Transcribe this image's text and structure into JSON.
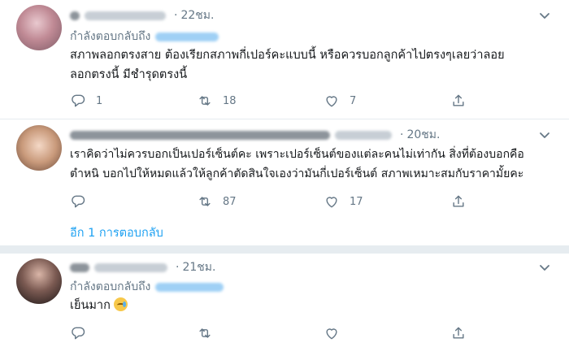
{
  "tweets": [
    {
      "time": "22ชม.",
      "reply_prefix": "กำลังตอบกลับถึง",
      "lines": [
        "สภาพลอกตรงสาย  ต้องเรียกสภาพกี่เปอร์คะแบบนี้    หรือควรบอกลูกค้าไปตรงๆเลยว่าลอย",
        "ลอกตรงนี้ มีชำรุดตรงนี้"
      ],
      "reply_count": "1",
      "retweet_count": "18",
      "like_count": "7"
    },
    {
      "time": "20ชม.",
      "lines": [
        "เราคิดว่าไม่ควรบอกเป็นเปอร์เซ็นต์คะ  เพราะเปอร์เซ็นต์ของแต่ละคนไม่เท่ากัน  สิ่งที่ต้องบอกคือ",
        "ตำหนิ  บอกไปให้หมดแล้วให้ลูกค้าตัดสินใจเองว่ามันกี่เปอร์เซ็นต์  สภาพเหมาะสมกับราคามั้ยคะ"
      ],
      "reply_count": "",
      "retweet_count": "87",
      "like_count": "17"
    },
    {
      "time": "21ชม.",
      "reply_prefix": "กำลังตอบกลับถึง",
      "lines": [
        "เย็นมาก"
      ],
      "emoji": "crying-face-emoji",
      "reply_count": "",
      "retweet_count": "",
      "like_count": ""
    }
  ],
  "show_more": "อีก 1 การตอบกลับ",
  "icons": [
    "chevron-down-icon",
    "reply-icon",
    "retweet-icon",
    "like-icon",
    "share-icon"
  ],
  "colors": {
    "link": "#1da1f2",
    "muted": "#657786",
    "divider": "#e6ecf0",
    "text": "#14171a"
  }
}
